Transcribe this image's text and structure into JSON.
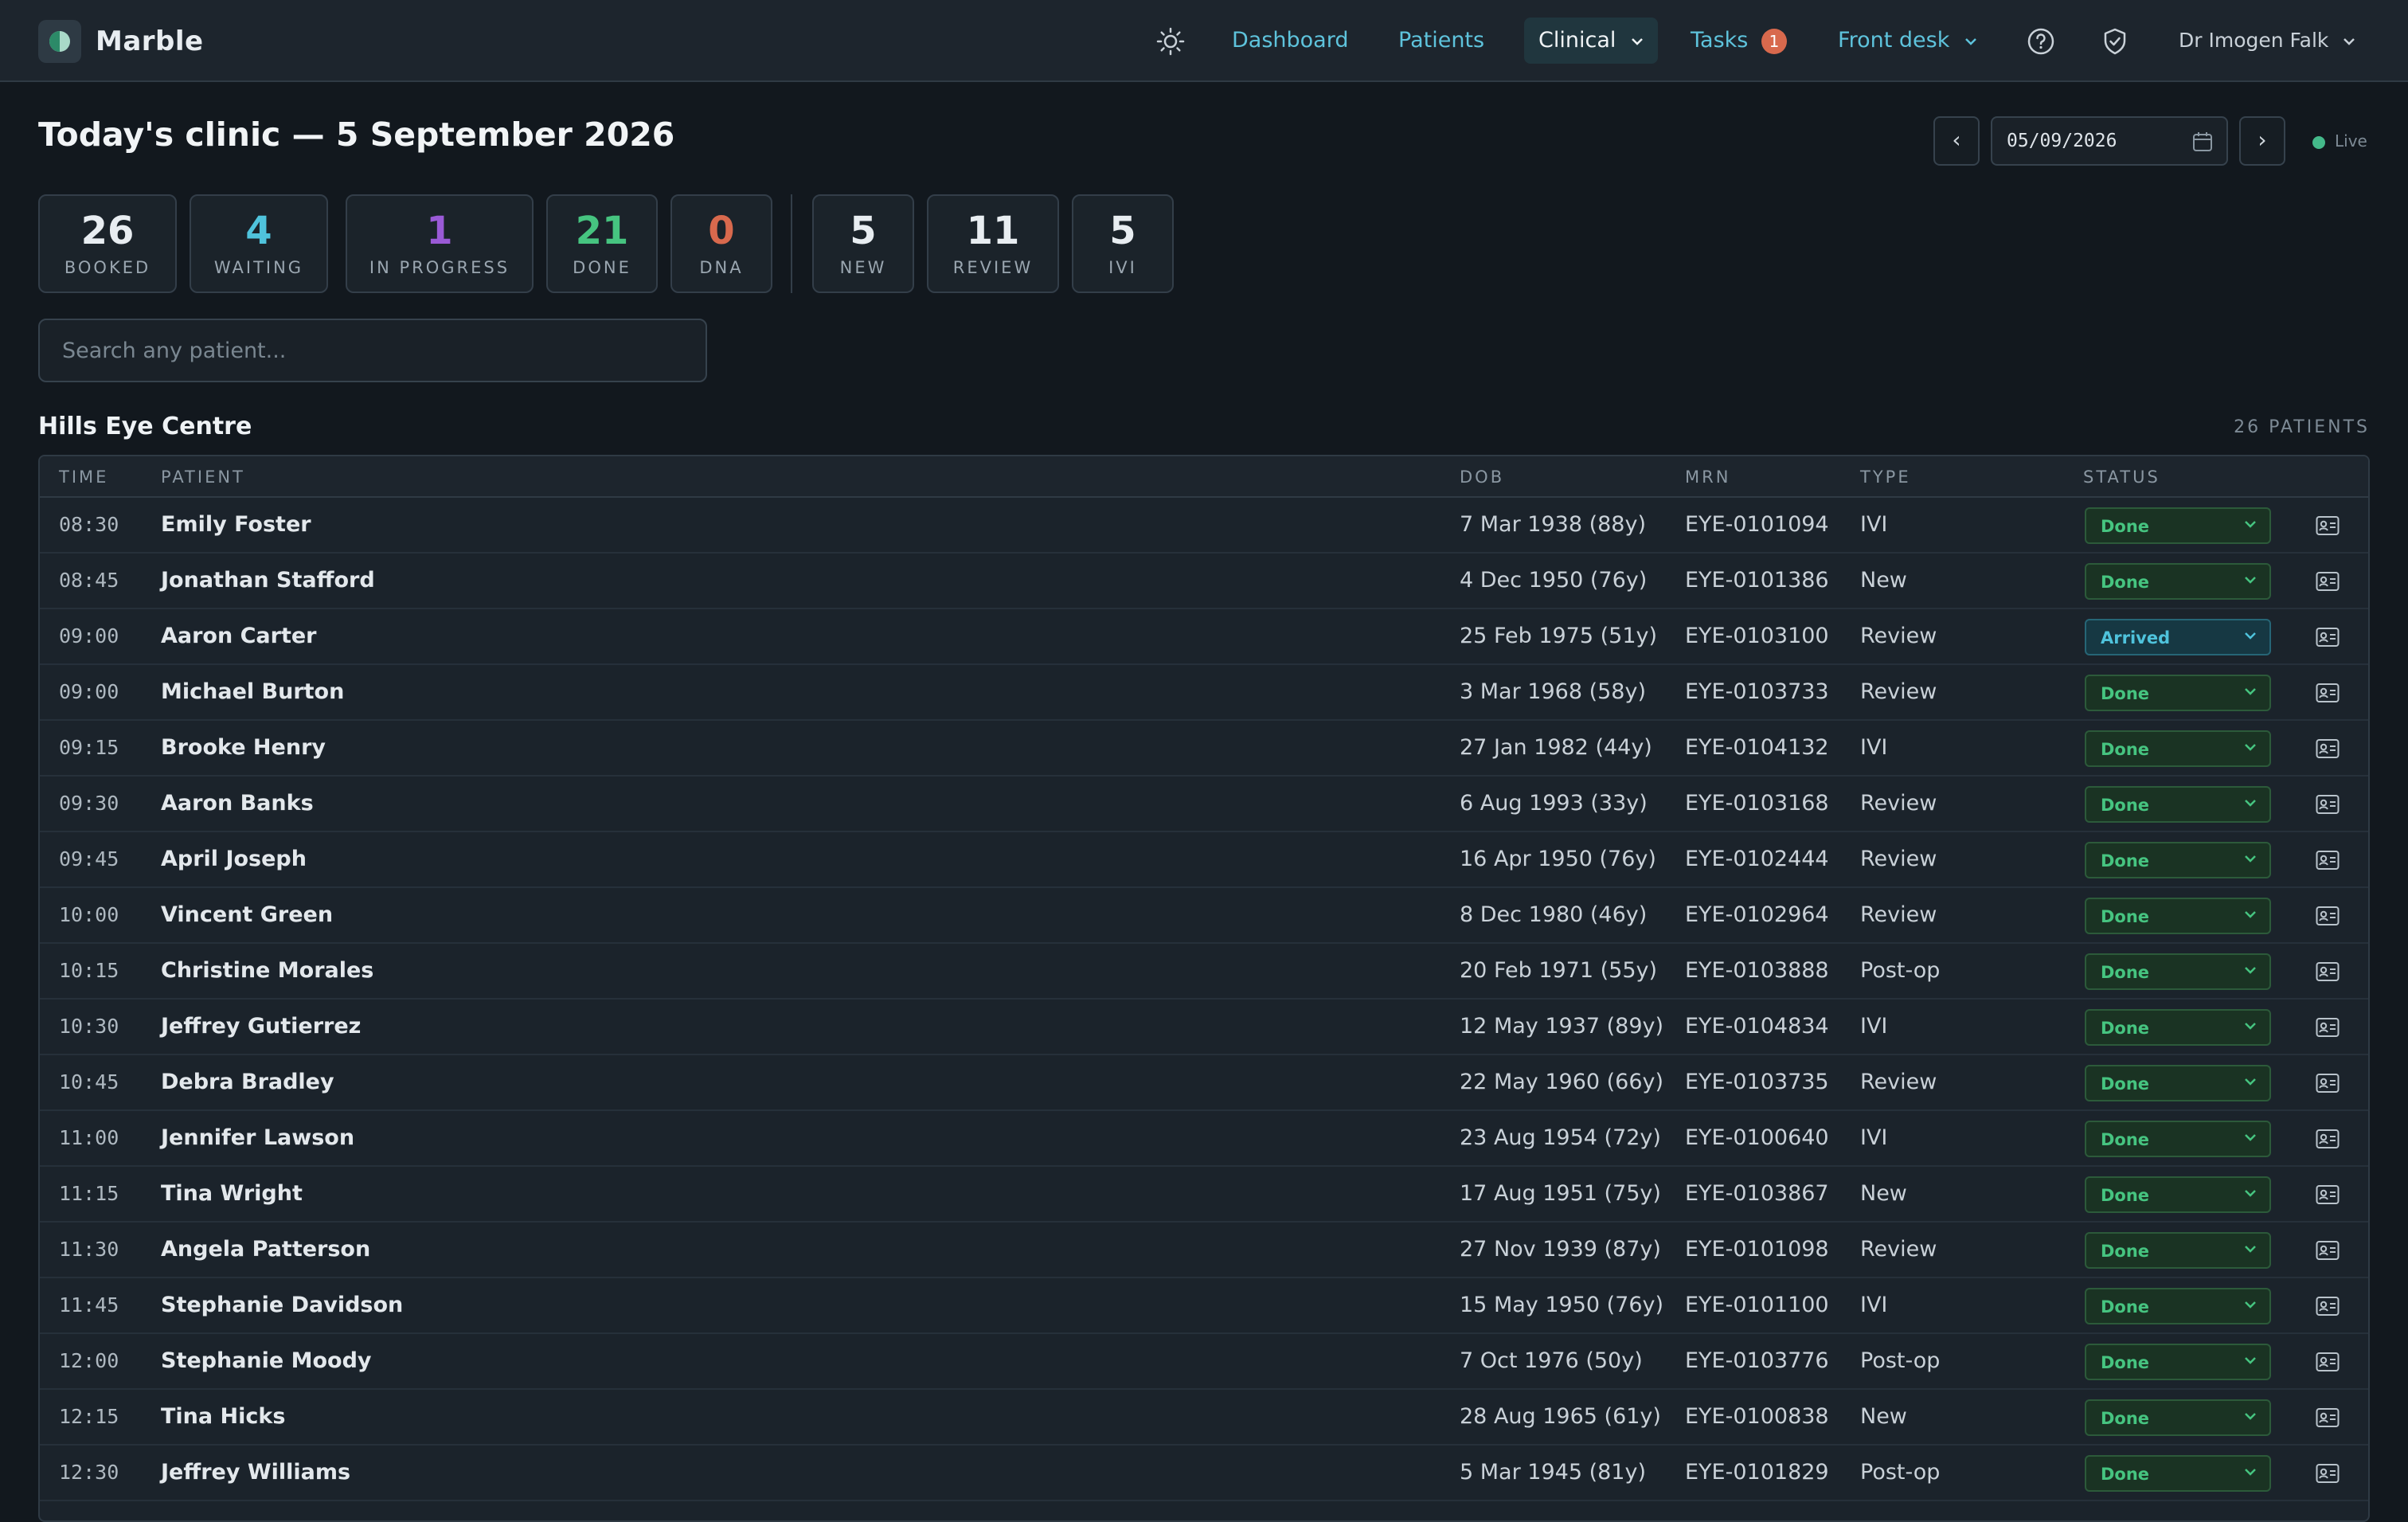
{
  "app": {
    "name": "Marble"
  },
  "nav": {
    "items": [
      {
        "label": "Dashboard"
      },
      {
        "label": "Patients"
      },
      {
        "label": "Clinical"
      },
      {
        "label": "Tasks",
        "badge": "1"
      },
      {
        "label": "Front desk"
      }
    ],
    "user": "Dr Imogen Falk"
  },
  "header": {
    "title": "Today's clinic — 5 September 2026",
    "date_value": "05/09/2026",
    "prev_label": "‹",
    "next_label": "›",
    "live_label": "Live"
  },
  "stats": [
    {
      "value": "26",
      "label": "BOOKED",
      "color": "#e8edf1"
    },
    {
      "value": "4",
      "label": "WAITING",
      "color": "#4fc3dc"
    },
    {
      "value": "1",
      "label": "IN PROGRESS",
      "color": "#9a5ad6"
    },
    {
      "value": "21",
      "label": "DONE",
      "color": "#46c480"
    },
    {
      "value": "0",
      "label": "DNA",
      "color": "#d8694d"
    },
    {
      "value": "5",
      "label": "NEW",
      "color": "#e8edf1"
    },
    {
      "value": "11",
      "label": "REVIEW",
      "color": "#e8edf1"
    },
    {
      "value": "5",
      "label": "IVI",
      "color": "#e8edf1"
    }
  ],
  "search": {
    "placeholder": "Search any patient..."
  },
  "clinic": {
    "name": "Hills Eye Centre",
    "count": "26 PATIENTS",
    "columns": [
      "TIME",
      "PATIENT",
      "DOB",
      "MRN",
      "TYPE",
      "STATUS"
    ],
    "rows": [
      {
        "time": "08:30",
        "patient": "Emily Foster",
        "dob": "7 Mar 1938 (88y)",
        "mrn": "EYE-0101094",
        "type": "IVI",
        "status": "Done"
      },
      {
        "time": "08:45",
        "patient": "Jonathan Stafford",
        "dob": "4 Dec 1950 (76y)",
        "mrn": "EYE-0101386",
        "type": "New",
        "status": "Done"
      },
      {
        "time": "09:00",
        "patient": "Aaron Carter",
        "dob": "25 Feb 1975 (51y)",
        "mrn": "EYE-0103100",
        "type": "Review",
        "status": "Arrived"
      },
      {
        "time": "09:00",
        "patient": "Michael Burton",
        "dob": "3 Mar 1968 (58y)",
        "mrn": "EYE-0103733",
        "type": "Review",
        "status": "Done"
      },
      {
        "time": "09:15",
        "patient": "Brooke Henry",
        "dob": "27 Jan 1982 (44y)",
        "mrn": "EYE-0104132",
        "type": "IVI",
        "status": "Done"
      },
      {
        "time": "09:30",
        "patient": "Aaron Banks",
        "dob": "6 Aug 1993 (33y)",
        "mrn": "EYE-0103168",
        "type": "Review",
        "status": "Done"
      },
      {
        "time": "09:45",
        "patient": "April Joseph",
        "dob": "16 Apr 1950 (76y)",
        "mrn": "EYE-0102444",
        "type": "Review",
        "status": "Done"
      },
      {
        "time": "10:00",
        "patient": "Vincent Green",
        "dob": "8 Dec 1980 (46y)",
        "mrn": "EYE-0102964",
        "type": "Review",
        "status": "Done"
      },
      {
        "time": "10:15",
        "patient": "Christine Morales",
        "dob": "20 Feb 1971 (55y)",
        "mrn": "EYE-0103888",
        "type": "Post-op",
        "status": "Done"
      },
      {
        "time": "10:30",
        "patient": "Jeffrey Gutierrez",
        "dob": "12 May 1937 (89y)",
        "mrn": "EYE-0104834",
        "type": "IVI",
        "status": "Done"
      },
      {
        "time": "10:45",
        "patient": "Debra Bradley",
        "dob": "22 May 1960 (66y)",
        "mrn": "EYE-0103735",
        "type": "Review",
        "status": "Done"
      },
      {
        "time": "11:00",
        "patient": "Jennifer Lawson",
        "dob": "23 Aug 1954 (72y)",
        "mrn": "EYE-0100640",
        "type": "IVI",
        "status": "Done"
      },
      {
        "time": "11:15",
        "patient": "Tina Wright",
        "dob": "17 Aug 1951 (75y)",
        "mrn": "EYE-0103867",
        "type": "New",
        "status": "Done"
      },
      {
        "time": "11:30",
        "patient": "Angela Patterson",
        "dob": "27 Nov 1939 (87y)",
        "mrn": "EYE-0101098",
        "type": "Review",
        "status": "Done"
      },
      {
        "time": "11:45",
        "patient": "Stephanie Davidson",
        "dob": "15 May 1950 (76y)",
        "mrn": "EYE-0101100",
        "type": "IVI",
        "status": "Done"
      },
      {
        "time": "12:00",
        "patient": "Stephanie Moody",
        "dob": "7 Oct 1976 (50y)",
        "mrn": "EYE-0103776",
        "type": "Post-op",
        "status": "Done"
      },
      {
        "time": "12:15",
        "patient": "Tina Hicks",
        "dob": "28 Aug 1965 (61y)",
        "mrn": "EYE-0100838",
        "type": "New",
        "status": "Done"
      },
      {
        "time": "12:30",
        "patient": "Jeffrey Williams",
        "dob": "5 Mar 1945 (81y)",
        "mrn": "EYE-0101829",
        "type": "Post-op",
        "status": "Done"
      }
    ]
  },
  "colors": {
    "accent": "#5ec3dc",
    "done": "#46c480",
    "arrived": "#4fc3dc",
    "badge": "#d8694d"
  },
  "icons": [
    "brand-logo-icon",
    "sun-icon",
    "help-icon",
    "shield-icon",
    "calendar-icon",
    "chevron-down-icon",
    "id-card-icon"
  ]
}
